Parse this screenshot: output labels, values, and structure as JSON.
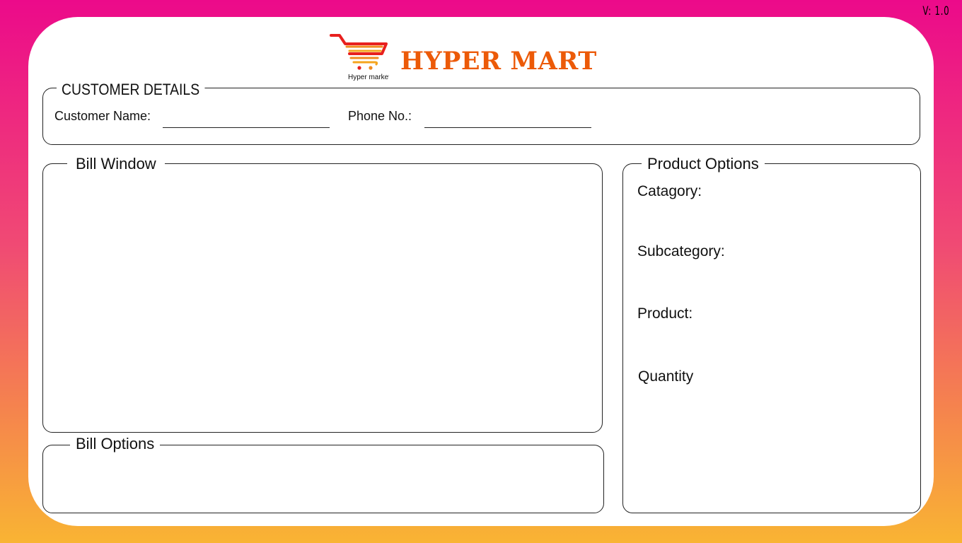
{
  "app": {
    "version": "V: 1.0",
    "brand": "HYPER MART",
    "logo_caption": "Hyper market",
    "brand_color": "#ec5a08"
  },
  "customer_details": {
    "legend": "CUSTOMER DETAILS",
    "name_label": "Customer Name:",
    "name_value": "",
    "phone_label": "Phone No.:",
    "phone_value": ""
  },
  "bill_window": {
    "legend": "Bill Window"
  },
  "bill_options": {
    "legend": "Bill Options"
  },
  "product_options": {
    "legend": "Product Options",
    "category_label": "Catagory:",
    "subcategory_label": "Subcategory:",
    "product_label": "Product:",
    "quantity_label": "Quantity"
  }
}
